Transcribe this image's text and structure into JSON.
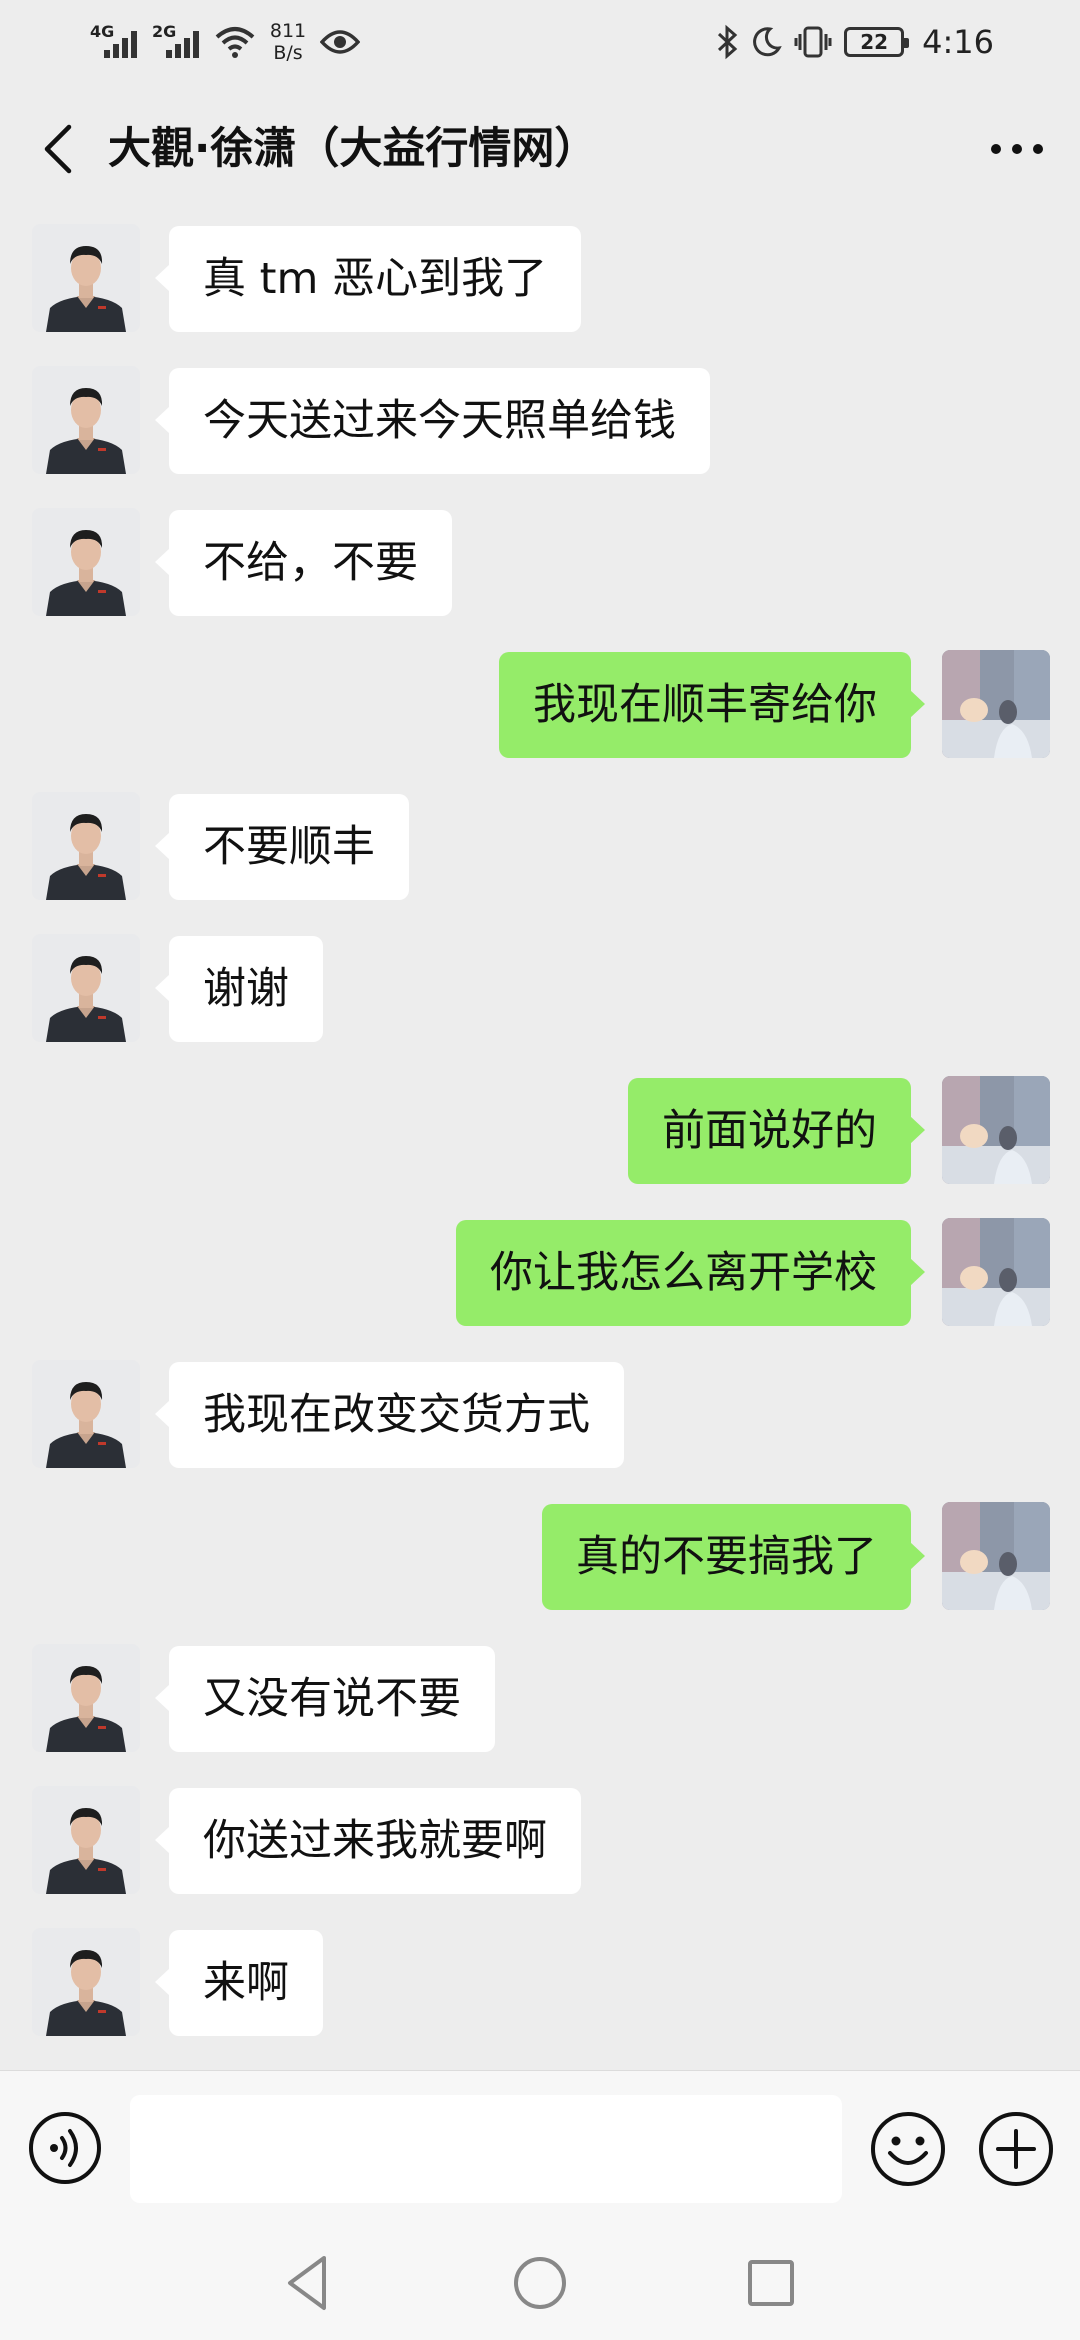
{
  "status_bar": {
    "network1": "4G",
    "network2": "2G",
    "net_speed_value": "811",
    "net_speed_unit": "B/s",
    "battery": "22",
    "time": "4:16"
  },
  "header": {
    "title": "大觀·徐潇（大益行情网）"
  },
  "messages": [
    {
      "side": "in",
      "text": "真 tm 恶心到我了"
    },
    {
      "side": "in",
      "text": "今天送过来今天照单给钱"
    },
    {
      "side": "in",
      "text": "不给，不要"
    },
    {
      "side": "out",
      "text": "我现在顺丰寄给你"
    },
    {
      "side": "in",
      "text": "不要顺丰"
    },
    {
      "side": "in",
      "text": "谢谢"
    },
    {
      "side": "out",
      "text": "前面说好的"
    },
    {
      "side": "out",
      "text": "你让我怎么离开学校"
    },
    {
      "side": "in",
      "text": "我现在改变交货方式"
    },
    {
      "side": "out",
      "text": "真的不要搞我了"
    },
    {
      "side": "in",
      "text": "又没有说不要"
    },
    {
      "side": "in",
      "text": "你送过来我就要啊"
    },
    {
      "side": "in",
      "text": "来啊"
    },
    {
      "side": "out",
      "text": ""
    }
  ],
  "input_bar": {
    "input_value": "",
    "icons": [
      "voice-icon",
      "emoji-icon",
      "plus-icon"
    ]
  },
  "nav_bar": {
    "icons": [
      "nav-back-icon",
      "nav-home-icon",
      "nav-recent-icon"
    ]
  },
  "colors": {
    "background": "#ededed",
    "outgoing_bubble": "#95ec69",
    "incoming_bubble": "#ffffff",
    "bar": "#f7f7f7"
  }
}
